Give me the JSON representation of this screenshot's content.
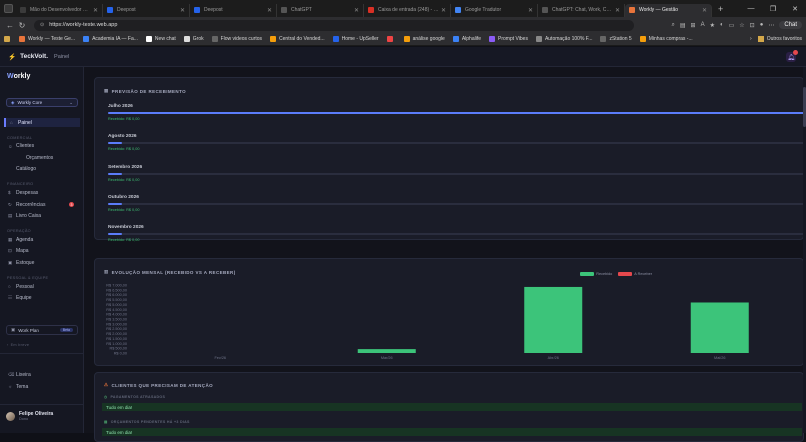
{
  "browser": {
    "tabs": [
      {
        "title": "Mão do Desenvolvedor Opo...",
        "color": "#3b3b3b",
        "active": false
      },
      {
        "title": "Deepost",
        "color": "#2563eb",
        "active": false
      },
      {
        "title": "Deepost",
        "color": "#2563eb",
        "active": false
      },
      {
        "title": "ChatGPT",
        "color": "#555555",
        "active": false
      },
      {
        "title": "Caixa de entrada (248) - bn...",
        "color": "#d93025",
        "active": false
      },
      {
        "title": "Google Tradutor",
        "color": "#4285f4",
        "active": false
      },
      {
        "title": "ChatGPT: Chat, Work, Crea...",
        "color": "#555555",
        "active": false
      },
      {
        "title": "Workly — Gestão",
        "color": "#e8743b",
        "active": true
      }
    ],
    "url": "https://workly-teste.web.app",
    "chat_label": "Chat",
    "bookmarks": [
      {
        "label": "Workly — Teste Ge...",
        "color": "#e8743b"
      },
      {
        "label": "Academia IA — Fa...",
        "color": "#3b82f6"
      },
      {
        "label": "New chat",
        "color": "#ffffff"
      },
      {
        "label": "Grok",
        "color": "#dddddd"
      },
      {
        "label": "Flow videos curtos",
        "color": "#666666"
      },
      {
        "label": "Central do Vended...",
        "color": "#f59e0b"
      },
      {
        "label": "Home - UpSeller",
        "color": "#2563eb"
      },
      {
        "label": "",
        "color": "#ef4444"
      },
      {
        "label": "análise google",
        "color": "#f59e0b"
      },
      {
        "label": "Alphalife",
        "color": "#3b82f6"
      },
      {
        "label": "Prompt Vibes",
        "color": "#8b5cf6"
      },
      {
        "label": "Automação 100% F...",
        "color": "#888888"
      },
      {
        "label": "zStation 5",
        "color": "#666666"
      },
      {
        "label": "Minhas compras -...",
        "color": "#f59e0b"
      }
    ],
    "other_favorites": "Outros favoritos"
  },
  "topbar": {
    "brand": "TeckVolt.",
    "crumb": "Painel"
  },
  "sidebar": {
    "logo": "Workly",
    "workspace": "Workly Core",
    "items": [
      {
        "label": "Painel",
        "icon": "home-icon",
        "active": true
      },
      {
        "section": "COMERCIAL"
      },
      {
        "label": "Clientes",
        "icon": "users-icon"
      },
      {
        "label": "Orçamentos",
        "icon": "file-icon",
        "indent": true
      },
      {
        "label": "Catálogo",
        "icon": "box-icon"
      },
      {
        "section": "FINANCEIRO"
      },
      {
        "label": "Despesas",
        "icon": "dollar-icon"
      },
      {
        "label": "Recorrências",
        "icon": "repeat-icon",
        "badge": "3"
      },
      {
        "label": "Livro Caixa",
        "icon": "book-icon"
      },
      {
        "section": "OPERAÇÃO"
      },
      {
        "label": "Agenda",
        "icon": "calendar-icon"
      },
      {
        "label": "Mapa",
        "icon": "map-icon"
      },
      {
        "label": "Estoque",
        "icon": "package-icon"
      },
      {
        "section": "PESSOAL & EQUIPE"
      },
      {
        "label": "Pessoal",
        "icon": "user-icon"
      },
      {
        "label": "Equipe",
        "icon": "team-icon"
      }
    ],
    "work_plan": "Work Plan",
    "work_plan_tag": "Beta",
    "footer_section": "Em breve",
    "bottom": [
      {
        "label": "Lixeira",
        "icon": "trash-icon"
      },
      {
        "label": "Tema",
        "icon": "sun-icon"
      }
    ],
    "user_name": "Felipe Oliveira",
    "user_role": "Dono"
  },
  "forecast": {
    "title": "PREVISÃO DE RECEBIMENTO",
    "rows": [
      {
        "month": "Julho 2026",
        "received": "Recebido: R$ 0,00",
        "progress": 1.0
      },
      {
        "month": "Agosto 2026",
        "received": "Recebido: R$ 0,00",
        "progress": 0.02
      },
      {
        "month": "Setembro 2026",
        "received": "Recebido: R$ 0,00",
        "progress": 0.02
      },
      {
        "month": "Outubro 2026",
        "received": "Recebido: R$ 0,00",
        "progress": 0.02
      },
      {
        "month": "Novembro 2026",
        "received": "Recebido: R$ 0,00",
        "progress": 0.02
      }
    ]
  },
  "evolution": {
    "title": "EVOLUÇÃO MENSAL (RECEBIDO VS A RECEBER)",
    "legend": [
      {
        "name": "Recebido",
        "color": "#3cc47a"
      },
      {
        "name": "A Receber",
        "color": "#e5484d"
      }
    ]
  },
  "chart_data": {
    "type": "bar",
    "title": "EVOLUÇÃO MENSAL (RECEBIDO VS A RECEBER)",
    "categories": [
      "Fev/26",
      "Mar/26",
      "Abr/26",
      "Mai/26"
    ],
    "series": [
      {
        "name": "Recebido",
        "values": [
          0,
          400,
          6800,
          5200
        ],
        "color": "#3cc47a"
      },
      {
        "name": "A Receber",
        "values": [
          0,
          0,
          0,
          0
        ],
        "color": "#e5484d"
      }
    ],
    "yticks": [
      "R$ 7.000,00",
      "R$ 6.500,00",
      "R$ 6.000,00",
      "R$ 5.500,00",
      "R$ 5.000,00",
      "R$ 4.500,00",
      "R$ 4.000,00",
      "R$ 3.500,00",
      "R$ 3.000,00",
      "R$ 2.500,00",
      "R$ 2.000,00",
      "R$ 1.500,00",
      "R$ 1.000,00",
      "R$ 500,00",
      "R$ 0,00"
    ],
    "ylim": [
      0,
      7000
    ],
    "legend_position": "top-right"
  },
  "attention": {
    "title": "CLIENTES QUE PRECISAM DE ATENÇÃO",
    "sections": [
      {
        "heading": "PAGAMENTOS ATRASADOS",
        "status": "Tudo em dia!"
      },
      {
        "heading": "ORÇAMENTOS PENDENTES HÁ +3 DIAS",
        "status": "Tudo em dia!"
      }
    ]
  }
}
